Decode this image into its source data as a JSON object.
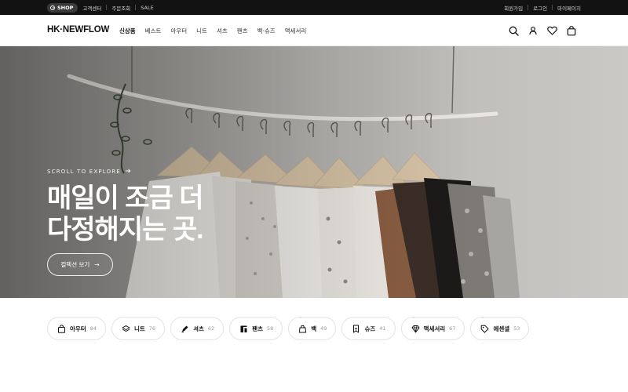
{
  "topbar": {
    "shop_label": "SHOP",
    "left_links": [
      "고객센터",
      "주문조회",
      "SALE"
    ],
    "right_links": [
      "회원가입",
      "로그인",
      "마이페이지"
    ]
  },
  "header": {
    "logo": "HK·NEWFLOW",
    "nav": [
      "신상품",
      "베스트",
      "아우터",
      "니트",
      "셔츠",
      "팬츠",
      "백·슈즈",
      "액세서리"
    ],
    "active_nav": "신상품",
    "icons": [
      "search-icon",
      "user-icon",
      "heart-icon",
      "bag-icon"
    ]
  },
  "hero": {
    "scroll_hint": "SCROLL TO EXPLORE",
    "headline_line1": "매일이 조금 더",
    "headline_line2": "다정해지는 곳.",
    "cta_label": "컬렉션 보기",
    "cta_arrow": "→"
  },
  "categories": [
    {
      "label": "아우터",
      "count": "84",
      "icon": "shopping-bag-icon"
    },
    {
      "label": "니트",
      "count": "76",
      "icon": "layers-icon"
    },
    {
      "label": "셔츠",
      "count": "62",
      "icon": "pen-icon"
    },
    {
      "label": "팬츠",
      "count": "58",
      "icon": "pants-icon"
    },
    {
      "label": "백",
      "count": "49",
      "icon": "handbag-icon"
    },
    {
      "label": "슈즈",
      "count": "41",
      "icon": "bookmark-icon"
    },
    {
      "label": "액세서리",
      "count": "67",
      "icon": "gem-icon"
    },
    {
      "label": "에센셜",
      "count": "53",
      "icon": "tag-icon"
    }
  ],
  "colors": {
    "topbar_bg": "#121212",
    "text_primary": "#111111",
    "chip_border": "#e4e4e4",
    "hero_text": "#ffffff"
  }
}
